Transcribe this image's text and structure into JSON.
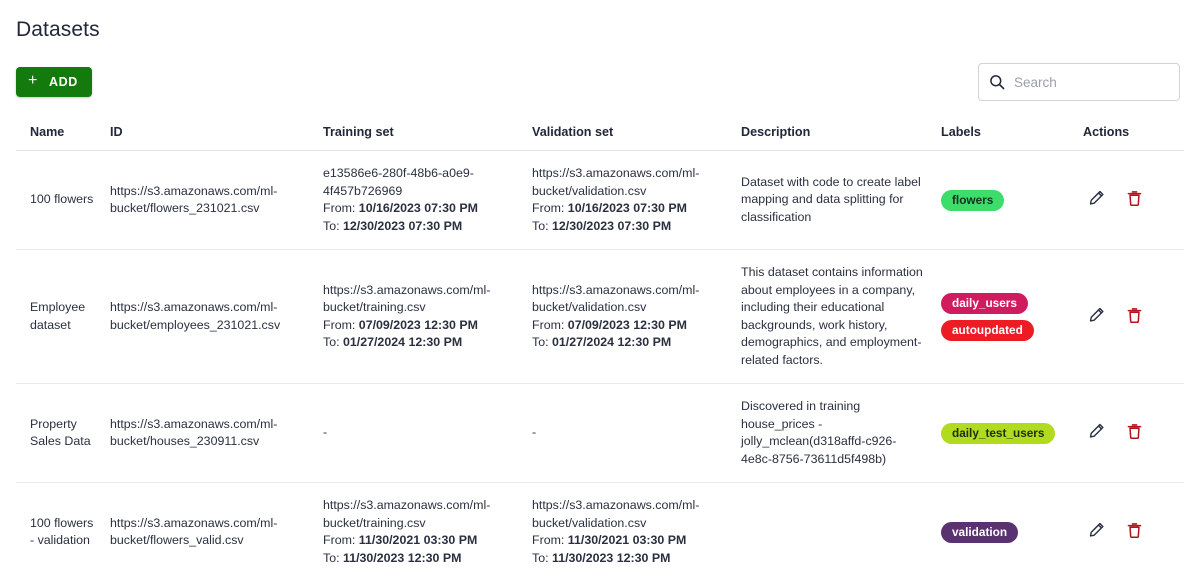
{
  "page": {
    "title": "Datasets"
  },
  "toolbar": {
    "add_label": "ADD",
    "add_icon": "plus-icon",
    "plus_glyph": "+",
    "search_placeholder": "Search",
    "search_value": "",
    "search_icon": "search-icon",
    "add_button_color": "#157a0d"
  },
  "table": {
    "columns": [
      {
        "key": "name",
        "label": "Name"
      },
      {
        "key": "id",
        "label": "ID"
      },
      {
        "key": "training_set",
        "label": "Training set"
      },
      {
        "key": "validation_set",
        "label": "Validation set"
      },
      {
        "key": "description",
        "label": "Description"
      },
      {
        "key": "labels",
        "label": "Labels"
      },
      {
        "key": "actions",
        "label": "Actions"
      }
    ],
    "from_prefix": "From:",
    "to_prefix": "To:",
    "empty_value": "-",
    "rows": [
      {
        "name": "100 flowers",
        "id": "https://s3.amazonaws.com/ml-bucket/flowers_231021.csv",
        "training_set": {
          "uri": "e13586e6-280f-48b6-a0e9-4f457b726969",
          "from": "10/16/2023 07:30 PM",
          "to": "12/30/2023 07:30 PM"
        },
        "validation_set": {
          "uri": "https://s3.amazonaws.com/ml-bucket/validation.csv",
          "from": "10/16/2023 07:30 PM",
          "to": "12/30/2023 07:30 PM"
        },
        "description": "Dataset with code to create label mapping and data splitting for classification",
        "labels": [
          {
            "text": "flowers",
            "bg": "#3ddc6b",
            "fg": "#15301e"
          }
        ]
      },
      {
        "name": "Employee dataset",
        "id": "https://s3.amazonaws.com/ml-bucket/employees_231021.csv",
        "training_set": {
          "uri": "https://s3.amazonaws.com/ml-bucket/training.csv",
          "from": "07/09/2023 12:30 PM",
          "to": "01/27/2024 12:30 PM"
        },
        "validation_set": {
          "uri": "https://s3.amazonaws.com/ml-bucket/validation.csv",
          "from": "07/09/2023 12:30 PM",
          "to": "01/27/2024 12:30 PM"
        },
        "description": "This dataset contains information about employees in a company, including their educational backgrounds, work history, demographics, and employment-related factors.",
        "labels": [
          {
            "text": "daily_users",
            "bg": "#d11b5f",
            "fg": "#ffffff"
          },
          {
            "text": "autoupdated",
            "bg": "#ec1c24",
            "fg": "#ffffff"
          }
        ]
      },
      {
        "name": "Property Sales Data",
        "id": "https://s3.amazonaws.com/ml-bucket/houses_230911.csv",
        "training_set": {
          "uri": "-",
          "from": "",
          "to": ""
        },
        "validation_set": {
          "uri": "-",
          "from": "",
          "to": ""
        },
        "description": "Discovered in training house_prices - jolly_mclean(d318affd-c926-4e8c-8756-73611d5f498b)",
        "labels": [
          {
            "text": "daily_test_users",
            "bg": "#b0db1e",
            "fg": "#23300a"
          }
        ]
      },
      {
        "name": "100 flowers - validation",
        "id": "https://s3.amazonaws.com/ml-bucket/flowers_valid.csv",
        "training_set": {
          "uri": "https://s3.amazonaws.com/ml-bucket/training.csv",
          "from": "11/30/2021 03:30 PM",
          "to": "11/30/2023 12:30 PM"
        },
        "validation_set": {
          "uri": "https://s3.amazonaws.com/ml-bucket/validation.csv",
          "from": "11/30/2021 03:30 PM",
          "to": "11/30/2023 12:30 PM"
        },
        "description": "",
        "labels": [
          {
            "text": "validation",
            "bg": "#5a3270",
            "fg": "#ffffff"
          }
        ]
      }
    ],
    "row_actions": [
      {
        "name": "edit-icon",
        "color": "#2b3244"
      },
      {
        "name": "delete-icon",
        "color": "#b3141c"
      }
    ]
  }
}
